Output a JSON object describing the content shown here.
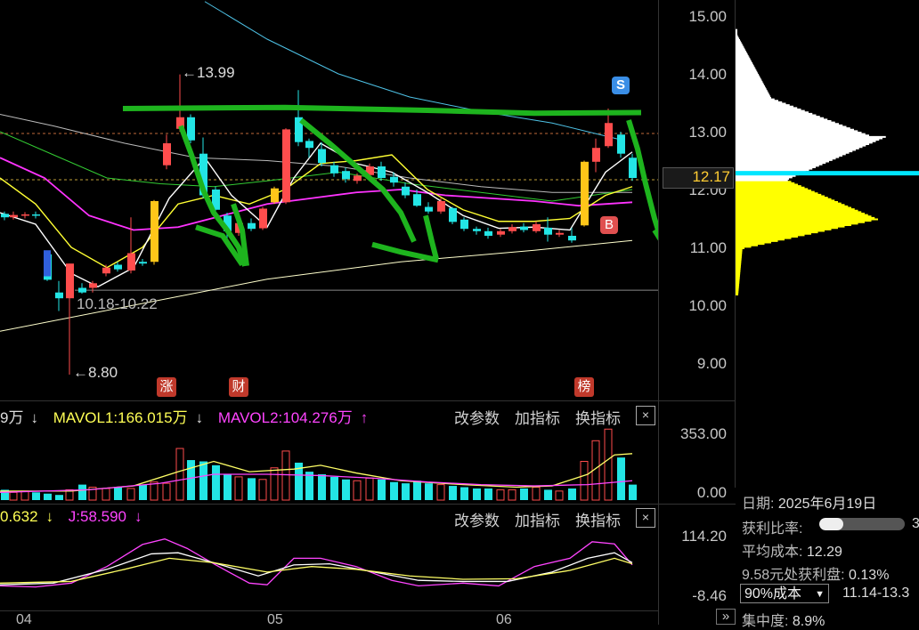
{
  "price_axis": [
    "15.00",
    "14.00",
    "13.00",
    "12.00",
    "11.00",
    "10.00",
    "9.00"
  ],
  "current_price": "12.17",
  "annotations": {
    "high_label": "13.99",
    "low_label": "8.80",
    "range_label": "10.18-10.22"
  },
  "event_tags": [
    {
      "label": "涨",
      "color": "#c0392b"
    },
    {
      "label": "财",
      "color": "#c0392b"
    },
    {
      "label": "榜",
      "color": "#c0392b"
    }
  ],
  "signals": {
    "sell": "S",
    "buy": "B"
  },
  "volume_pane": {
    "partial_label": "9万",
    "mavol1": "MAVOL1:166.015万",
    "mavol1_arrow": "↓",
    "mavol2": "MAVOL2:104.276万",
    "mavol2_arrow": "↑",
    "axis_top": "353.00",
    "axis_bottom": "0.00",
    "buttons": [
      "改参数",
      "加指标",
      "换指标"
    ],
    "close": "×"
  },
  "kdj_pane": {
    "partial_label": "0.632",
    "partial_arrow": "↓",
    "j_label": "J:58.590",
    "j_arrow": "↓",
    "axis_top": "114.20",
    "axis_bottom": "-8.46",
    "buttons": [
      "改参数",
      "加指标",
      "换指标"
    ],
    "close": "×"
  },
  "date_axis": [
    "04",
    "05",
    "06"
  ],
  "chip_panel": {
    "date_key": "日期:",
    "date_value": "2025年6月19日",
    "profit_ratio_key": "获利比率:",
    "profit_ratio_value": "3",
    "profit_ratio_fill": 0.28,
    "avg_cost_key": "平均成本:",
    "avg_cost_value": "12.29",
    "profit_at_key": "9.58元处获利盘:",
    "profit_at_value": "0.13%",
    "cost_select": "90%成本",
    "cost_range": "11.14-13.3",
    "concentration_key": "集中度:",
    "concentration_value": "8.9%"
  },
  "colors": {
    "up": "#ff4d4d",
    "down": "#23e5e5",
    "limit": "#ffc619",
    "ma5": "#ffffff",
    "ma10": "#ffff33",
    "ma20": "#ff33ff",
    "ma60": "#33cc33",
    "marker": "#1eb41e",
    "chip_profit": "#ffff00",
    "chip_loss": "#ffffff",
    "chip_line": "#00e5ff"
  },
  "scroll_icon": "»"
}
